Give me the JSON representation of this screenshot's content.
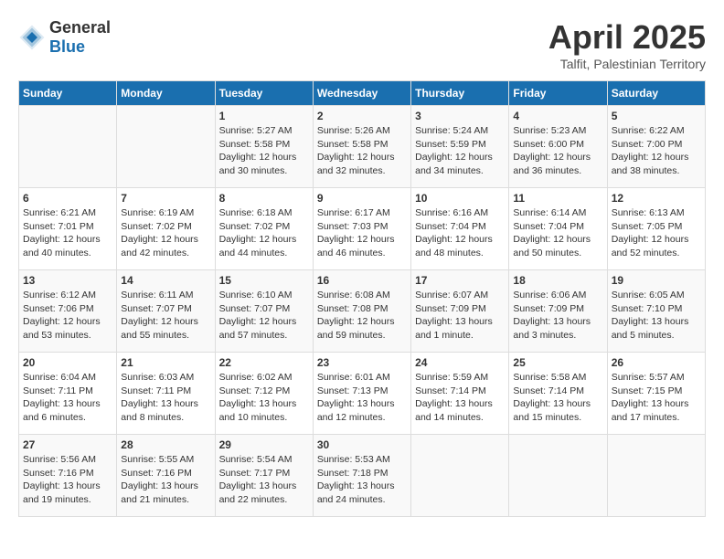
{
  "header": {
    "logo_general": "General",
    "logo_blue": "Blue",
    "month_year": "April 2025",
    "location": "Talfit, Palestinian Territory"
  },
  "days_of_week": [
    "Sunday",
    "Monday",
    "Tuesday",
    "Wednesday",
    "Thursday",
    "Friday",
    "Saturday"
  ],
  "weeks": [
    [
      {
        "day": "",
        "content": ""
      },
      {
        "day": "",
        "content": ""
      },
      {
        "day": "1",
        "content": "Sunrise: 5:27 AM\nSunset: 5:58 PM\nDaylight: 12 hours\nand 30 minutes."
      },
      {
        "day": "2",
        "content": "Sunrise: 5:26 AM\nSunset: 5:58 PM\nDaylight: 12 hours\nand 32 minutes."
      },
      {
        "day": "3",
        "content": "Sunrise: 5:24 AM\nSunset: 5:59 PM\nDaylight: 12 hours\nand 34 minutes."
      },
      {
        "day": "4",
        "content": "Sunrise: 5:23 AM\nSunset: 6:00 PM\nDaylight: 12 hours\nand 36 minutes."
      },
      {
        "day": "5",
        "content": "Sunrise: 6:22 AM\nSunset: 7:00 PM\nDaylight: 12 hours\nand 38 minutes."
      }
    ],
    [
      {
        "day": "6",
        "content": "Sunrise: 6:21 AM\nSunset: 7:01 PM\nDaylight: 12 hours\nand 40 minutes."
      },
      {
        "day": "7",
        "content": "Sunrise: 6:19 AM\nSunset: 7:02 PM\nDaylight: 12 hours\nand 42 minutes."
      },
      {
        "day": "8",
        "content": "Sunrise: 6:18 AM\nSunset: 7:02 PM\nDaylight: 12 hours\nand 44 minutes."
      },
      {
        "day": "9",
        "content": "Sunrise: 6:17 AM\nSunset: 7:03 PM\nDaylight: 12 hours\nand 46 minutes."
      },
      {
        "day": "10",
        "content": "Sunrise: 6:16 AM\nSunset: 7:04 PM\nDaylight: 12 hours\nand 48 minutes."
      },
      {
        "day": "11",
        "content": "Sunrise: 6:14 AM\nSunset: 7:04 PM\nDaylight: 12 hours\nand 50 minutes."
      },
      {
        "day": "12",
        "content": "Sunrise: 6:13 AM\nSunset: 7:05 PM\nDaylight: 12 hours\nand 52 minutes."
      }
    ],
    [
      {
        "day": "13",
        "content": "Sunrise: 6:12 AM\nSunset: 7:06 PM\nDaylight: 12 hours\nand 53 minutes."
      },
      {
        "day": "14",
        "content": "Sunrise: 6:11 AM\nSunset: 7:07 PM\nDaylight: 12 hours\nand 55 minutes."
      },
      {
        "day": "15",
        "content": "Sunrise: 6:10 AM\nSunset: 7:07 PM\nDaylight: 12 hours\nand 57 minutes."
      },
      {
        "day": "16",
        "content": "Sunrise: 6:08 AM\nSunset: 7:08 PM\nDaylight: 12 hours\nand 59 minutes."
      },
      {
        "day": "17",
        "content": "Sunrise: 6:07 AM\nSunset: 7:09 PM\nDaylight: 13 hours\nand 1 minute."
      },
      {
        "day": "18",
        "content": "Sunrise: 6:06 AM\nSunset: 7:09 PM\nDaylight: 13 hours\nand 3 minutes."
      },
      {
        "day": "19",
        "content": "Sunrise: 6:05 AM\nSunset: 7:10 PM\nDaylight: 13 hours\nand 5 minutes."
      }
    ],
    [
      {
        "day": "20",
        "content": "Sunrise: 6:04 AM\nSunset: 7:11 PM\nDaylight: 13 hours\nand 6 minutes."
      },
      {
        "day": "21",
        "content": "Sunrise: 6:03 AM\nSunset: 7:11 PM\nDaylight: 13 hours\nand 8 minutes."
      },
      {
        "day": "22",
        "content": "Sunrise: 6:02 AM\nSunset: 7:12 PM\nDaylight: 13 hours\nand 10 minutes."
      },
      {
        "day": "23",
        "content": "Sunrise: 6:01 AM\nSunset: 7:13 PM\nDaylight: 13 hours\nand 12 minutes."
      },
      {
        "day": "24",
        "content": "Sunrise: 5:59 AM\nSunset: 7:14 PM\nDaylight: 13 hours\nand 14 minutes."
      },
      {
        "day": "25",
        "content": "Sunrise: 5:58 AM\nSunset: 7:14 PM\nDaylight: 13 hours\nand 15 minutes."
      },
      {
        "day": "26",
        "content": "Sunrise: 5:57 AM\nSunset: 7:15 PM\nDaylight: 13 hours\nand 17 minutes."
      }
    ],
    [
      {
        "day": "27",
        "content": "Sunrise: 5:56 AM\nSunset: 7:16 PM\nDaylight: 13 hours\nand 19 minutes."
      },
      {
        "day": "28",
        "content": "Sunrise: 5:55 AM\nSunset: 7:16 PM\nDaylight: 13 hours\nand 21 minutes."
      },
      {
        "day": "29",
        "content": "Sunrise: 5:54 AM\nSunset: 7:17 PM\nDaylight: 13 hours\nand 22 minutes."
      },
      {
        "day": "30",
        "content": "Sunrise: 5:53 AM\nSunset: 7:18 PM\nDaylight: 13 hours\nand 24 minutes."
      },
      {
        "day": "",
        "content": ""
      },
      {
        "day": "",
        "content": ""
      },
      {
        "day": "",
        "content": ""
      }
    ]
  ]
}
